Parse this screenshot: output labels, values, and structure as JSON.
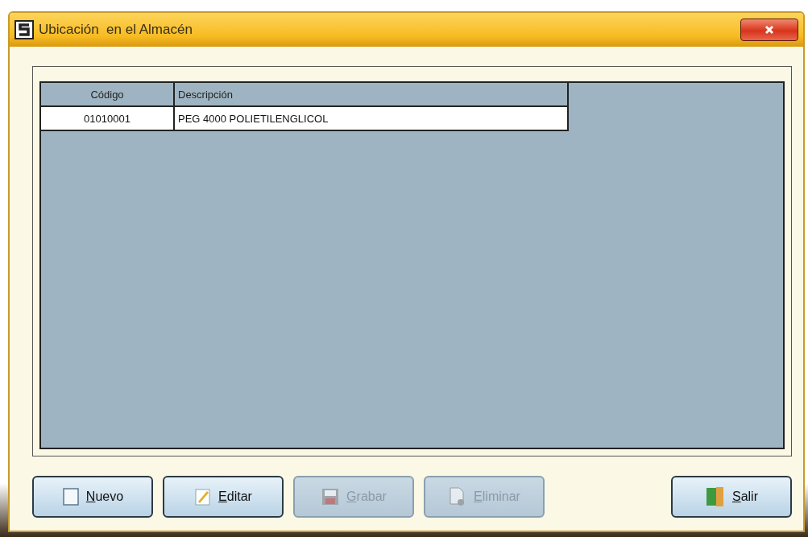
{
  "window": {
    "title": "Ubicación  en el Almacén"
  },
  "table": {
    "columns": [
      "Código",
      "Descripción"
    ],
    "rows": [
      {
        "cells": [
          "01010001",
          "PEG 4000 POLIETILENGLICOL"
        ],
        "selected": false
      }
    ]
  },
  "buttons": [
    {
      "label": "Nuevo",
      "kind": "new",
      "disabled": false
    },
    {
      "label": "Editar",
      "kind": "edit",
      "disabled": false
    },
    {
      "label": "Grabar",
      "kind": "save",
      "disabled": true
    },
    {
      "label": "Eliminar",
      "kind": "delete",
      "disabled": true
    },
    {
      "label": "Salir",
      "kind": "exit",
      "disabled": false
    }
  ]
}
